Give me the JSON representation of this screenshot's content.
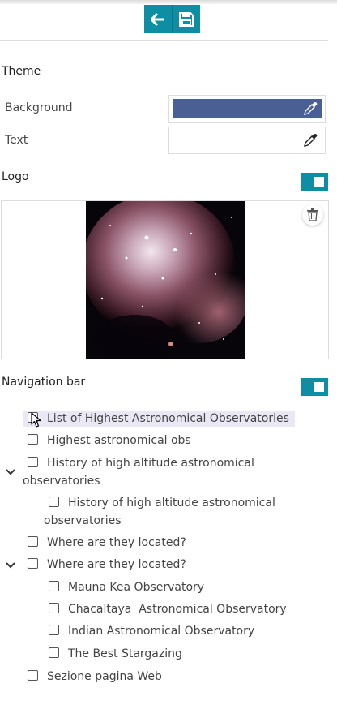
{
  "toolbar": {
    "back": "arrow-left-icon",
    "save": "save-icon"
  },
  "theme": {
    "title": "Theme",
    "background_label": "Background",
    "background_color": "#4a5f93",
    "text_label": "Text",
    "text_color": "#ffffff"
  },
  "logo": {
    "title": "Logo",
    "enabled": true
  },
  "navbar": {
    "title": "Navigation bar",
    "enabled": true,
    "items": [
      {
        "label": "List of Highest Astronomical Observatories",
        "highlighted": true
      },
      {
        "label": "Highest astronomical obs"
      },
      {
        "label": "History of high altitude astronomical observatories",
        "expanded": true
      },
      {
        "label": "History of high altitude astronomical observatories"
      },
      {
        "label": "Where are they located?"
      },
      {
        "label": "Where are they located?",
        "expanded": true
      },
      {
        "label": "Mauna Kea Observatory"
      },
      {
        "label": "Chacaltaya  Astronomical Observatory"
      },
      {
        "label": "Indian Astronomical Observatory"
      },
      {
        "label": "The Best Stargazing"
      },
      {
        "label": "Sezione pagina Web"
      }
    ]
  }
}
